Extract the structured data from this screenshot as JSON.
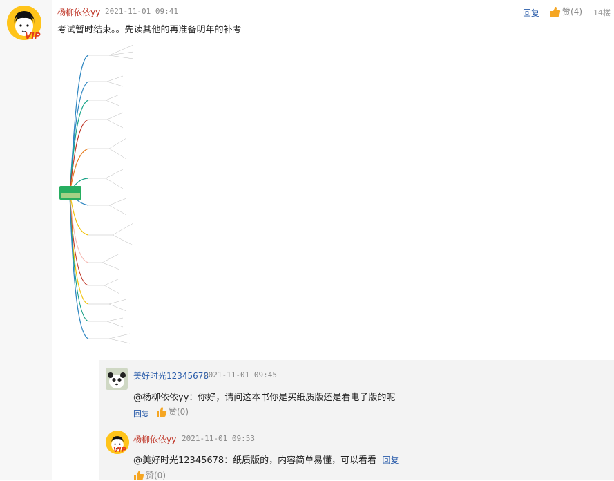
{
  "post": {
    "username": "杨柳依依yy",
    "time": "2021-11-01  09:41",
    "reply_label": "回复",
    "like_label": "赞(4)",
    "floor": "14楼",
    "content": "考试暂时结束。。先读其他的再准备明年的补考",
    "vip_text": "VIP",
    "mindmap_center_label": "管理学原理 · 思维导图"
  },
  "replies": [
    {
      "username": "美好时光12345678",
      "time": "2021-11-01  09:45",
      "content": "@杨柳依依yy：你好，请问这本书你是买纸质版还是看电子版的呢",
      "reply_label": "回复",
      "like_label": "赞(0)"
    },
    {
      "username": "杨柳依依yy",
      "time": "2021-11-01  09:53",
      "content": "@美好时光12345678：纸质版的，内容简单易懂，可以看看",
      "reply_label": "回复",
      "like_label": "赞(0)",
      "vip_text": "VIP"
    }
  ],
  "colors": {
    "username_red": "#c0392b",
    "link_blue": "#2a5caa",
    "thumb_orange": "#f5a623",
    "vip_red": "#e33b1a"
  },
  "icons": {
    "like": "thumbs-up-icon",
    "avatar": "cartoon-face-avatar",
    "panda": "panda-avatar"
  }
}
